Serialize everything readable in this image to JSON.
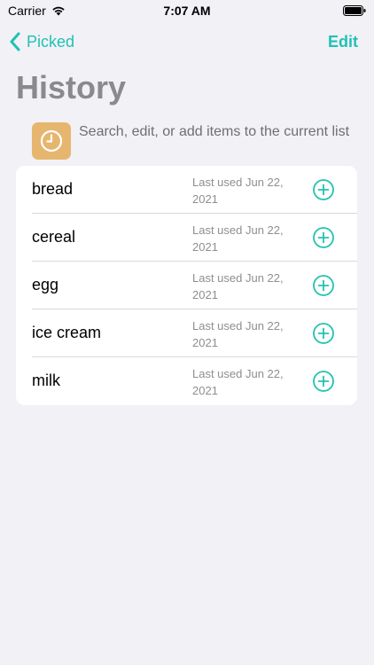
{
  "status_bar": {
    "carrier": "Carrier",
    "time": "7:07 AM"
  },
  "nav": {
    "back_label": "Picked",
    "edit_label": "Edit"
  },
  "title": "History",
  "header": {
    "icon": "clock-icon",
    "text": "Search, edit, or add items to the current list"
  },
  "items": [
    {
      "name": "bread",
      "last_used": "Last used Jun 22, 2021"
    },
    {
      "name": "cereal",
      "last_used": "Last used Jun 22, 2021"
    },
    {
      "name": "egg",
      "last_used": "Last used Jun 22, 2021"
    },
    {
      "name": "ice cream",
      "last_used": "Last used Jun 22, 2021"
    },
    {
      "name": "milk",
      "last_used": "Last used Jun 22, 2021"
    }
  ],
  "colors": {
    "accent": "#20c2b3",
    "badge": "#e6b66f",
    "background": "#f1f1f6"
  }
}
